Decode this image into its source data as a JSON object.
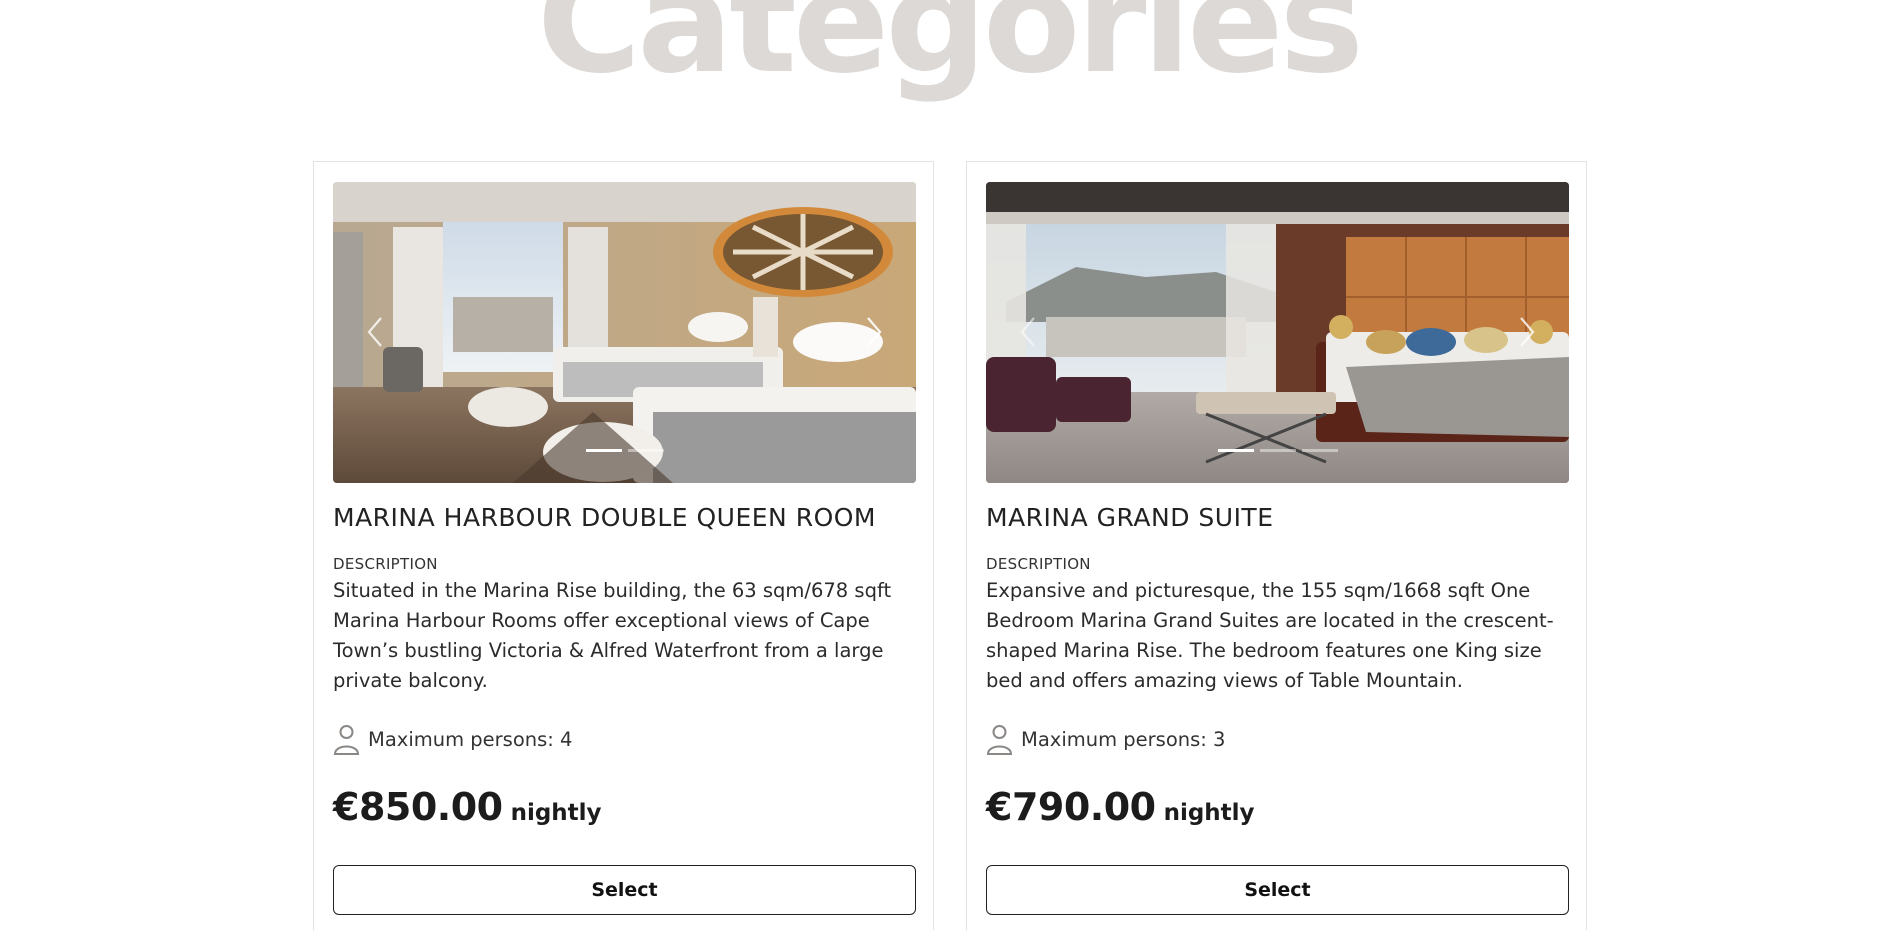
{
  "page": {
    "heading": "Categories"
  },
  "rooms": [
    {
      "title": "MARINA HARBOUR DOUBLE QUEEN ROOM",
      "description_label": "DESCRIPTION",
      "description": "Situated in the Marina Rise building, the 63 sqm/678 sqft Marina Harbour Rooms offer exceptional views of Cape Town’s bustling Victoria & Alfred Waterfront from a large private balcony.",
      "max_persons": "Maximum persons: 4",
      "price": "€850.00",
      "price_unit": "nightly",
      "select_label": "Select",
      "slides": 2,
      "active_slide": 1
    },
    {
      "title": "MARINA GRAND SUITE",
      "description_label": "DESCRIPTION",
      "description": "Expansive and picturesque, the 155 sqm/1668 sqft One Bedroom Marina Grand Suites are located in the crescent-shaped Marina Rise. The bedroom features one King size bed and offers amazing views of Table Mountain.",
      "max_persons": "Maximum persons: 3",
      "price": "€790.00",
      "price_unit": "nightly",
      "select_label": "Select",
      "slides": 3,
      "active_slide": 1
    }
  ],
  "icons": {
    "prev": "chevron-left-icon",
    "next": "chevron-right-icon",
    "person": "person-icon"
  },
  "colors": {
    "heading": "#dcd9d6",
    "text": "#222222",
    "border": "#e3e3e3"
  }
}
